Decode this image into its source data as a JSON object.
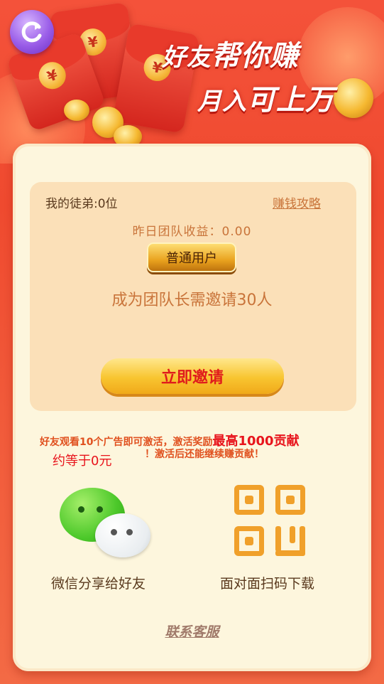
{
  "header": {
    "slogan_line1_a": "好友",
    "slogan_line1_b": "帮你赚",
    "slogan_line2_a": "月入",
    "slogan_line2_b": "可上万"
  },
  "stats": {
    "apprentice_count": "我的徒弟:0位",
    "guide_link": "赚钱攻略",
    "yesterday_income": "昨日团队收益：0.00",
    "user_level": "普通用户",
    "leader_requirement": "成为团队长需邀请30人"
  },
  "actions": {
    "invite_button": "立即邀请"
  },
  "notice": {
    "line1": "好友观看10个广告即可激活，激活奖励",
    "highlight": "最高1000贡献",
    "line2": "约等于0元",
    "line3": "！激活后还能继续赚贡献！"
  },
  "share": {
    "wechat_label": "微信分享给好友",
    "qr_label": "面对面扫码下载"
  },
  "footer": {
    "support_link": "联系客服"
  },
  "colors": {
    "background": "#f4523a",
    "card": "#fdf6dd",
    "panel": "#fbe0b8",
    "accent_text": "#c9743a",
    "invite_text": "#e01c1c",
    "back_button": "#9a5de8"
  },
  "icons": [
    "back-refresh-icon",
    "wechat-icon",
    "qr-code-icon"
  ]
}
